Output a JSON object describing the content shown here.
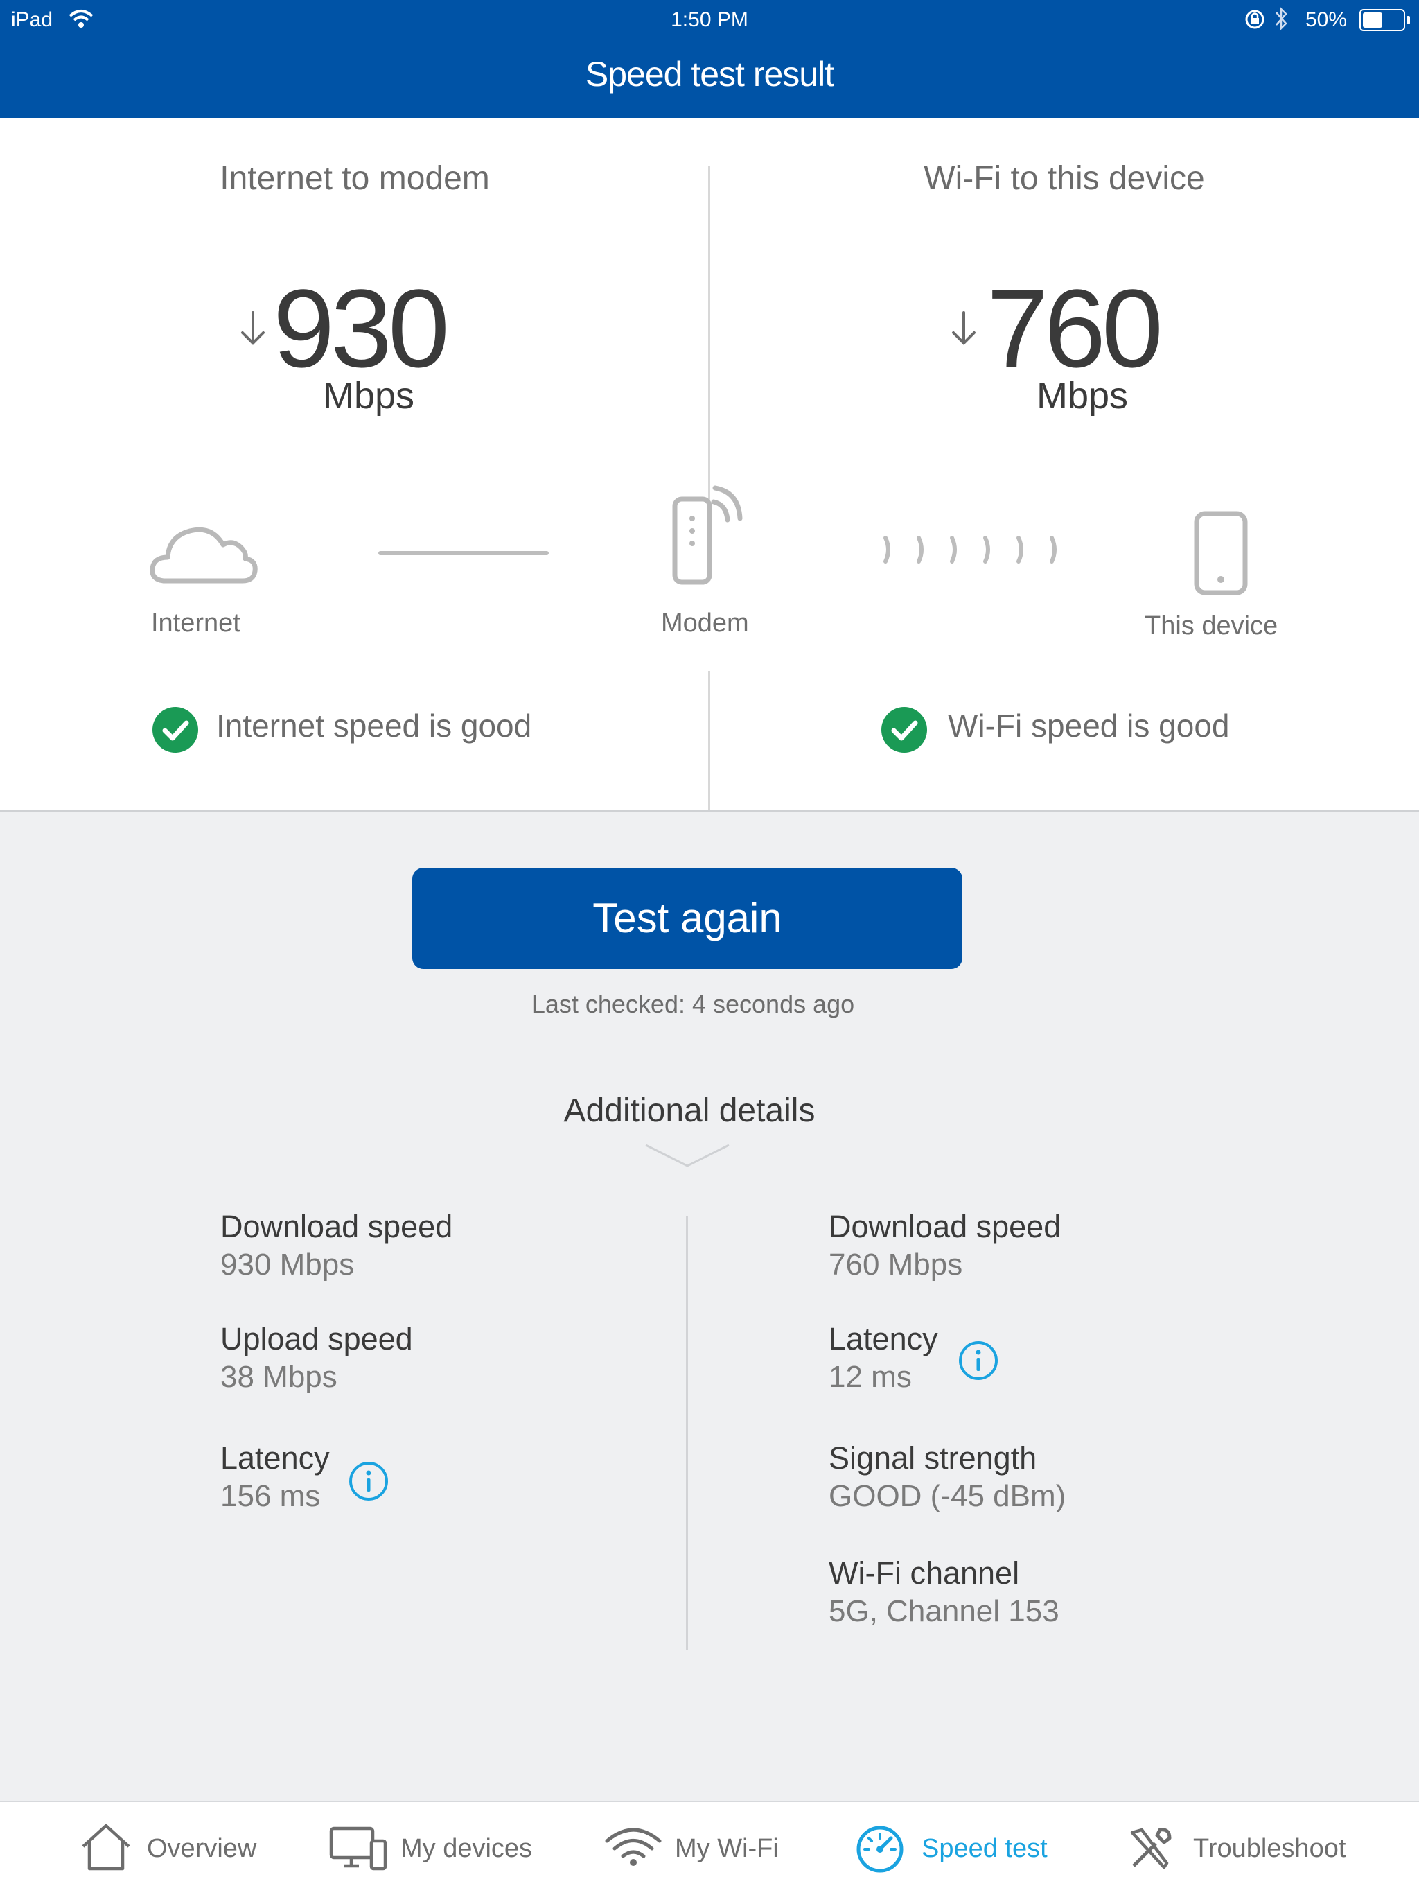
{
  "status_bar": {
    "device": "iPad",
    "time": "1:50 PM",
    "battery": "50%"
  },
  "header": {
    "title": "Speed test result"
  },
  "left_panel": {
    "title": "Internet to modem",
    "speed": "930",
    "unit": "Mbps",
    "status": "Internet speed is good"
  },
  "right_panel": {
    "title": "Wi-Fi to this device",
    "speed": "760",
    "unit": "Mbps",
    "status": "Wi-Fi speed is good"
  },
  "nodes": {
    "internet": "Internet",
    "modem": "Modem",
    "device": "This device"
  },
  "actions": {
    "test_again": "Test again",
    "last_checked": "Last checked: 4 seconds ago"
  },
  "details": {
    "title": "Additional details",
    "left": [
      {
        "label": "Download speed",
        "value": "930 Mbps"
      },
      {
        "label": "Upload speed",
        "value": "38 Mbps"
      },
      {
        "label": "Latency",
        "value": "156 ms"
      }
    ],
    "right": [
      {
        "label": "Download speed",
        "value": "760 Mbps"
      },
      {
        "label": "Latency",
        "value": "12 ms"
      },
      {
        "label": "Signal strength",
        "value": "GOOD (-45 dBm)"
      },
      {
        "label": "Wi-Fi channel",
        "value": "5G, Channel 153"
      }
    ]
  },
  "tabs": [
    {
      "label": "Overview",
      "icon": "home-icon"
    },
    {
      "label": "My devices",
      "icon": "devices-icon"
    },
    {
      "label": "My Wi-Fi",
      "icon": "wifi-icon"
    },
    {
      "label": "Speed test",
      "icon": "speedometer-icon",
      "active": true
    },
    {
      "label": "Troubleshoot",
      "icon": "tools-icon"
    }
  ],
  "colors": {
    "brand": "#0053a6",
    "good": "#1a9a55",
    "active_tab": "#1aa3e0"
  }
}
